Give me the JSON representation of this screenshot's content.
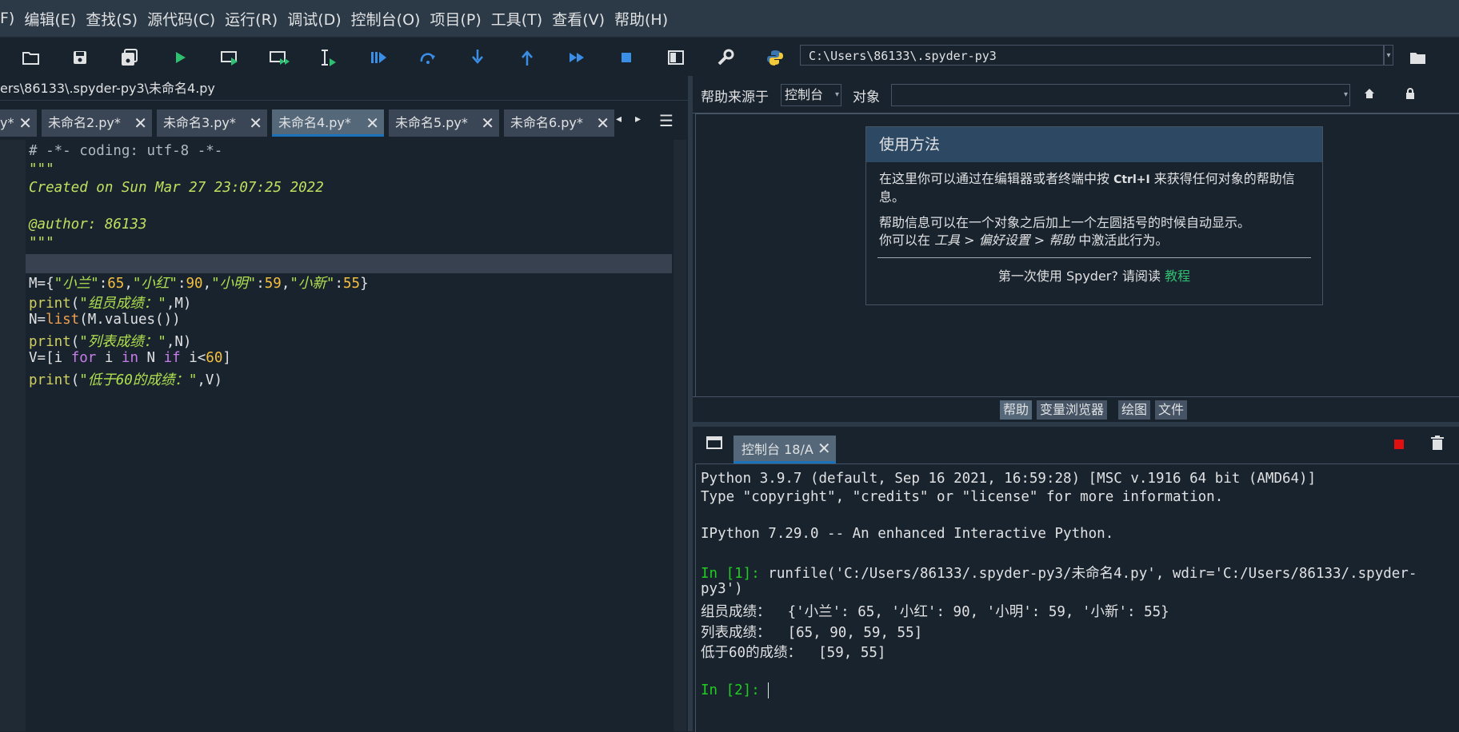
{
  "menu": [
    "F)",
    "编辑(E)",
    "查找(S)",
    "源代码(C)",
    "运行(R)",
    "调试(D)",
    "控制台(O)",
    "项目(P)",
    "工具(T)",
    "查看(V)",
    "帮助(H)"
  ],
  "toolbar": {
    "path": "C:\\Users\\86133\\.spyder-py3",
    "icons": [
      "open-folder",
      "save",
      "save-all",
      "run",
      "run-cell",
      "run-cell-advance",
      "run-selection",
      "debug",
      "step",
      "step-into",
      "step-return",
      "continue",
      "stop",
      "maximize-pane",
      "preferences",
      "pythonpath-manager"
    ]
  },
  "editor": {
    "path": "ers\\86133\\.spyder-py3\\未命名4.py",
    "tabs": [
      "y*",
      "未命名2.py*",
      "未命名3.py*",
      "未命名4.py*",
      "未命名5.py*",
      "未命名6.py*"
    ],
    "active_tab": "未命名4.py*",
    "code": {
      "l1": "# -*- coding: utf-8 -*-",
      "l2": "\"\"\"",
      "l3": "Created on Sun Mar 27 23:07:25 2022",
      "l5": "@author: 86133",
      "l6": "\"\"\"",
      "l8": {
        "a": "M={",
        "s1": "\"小兰\"",
        "b": ":",
        "n1": "65",
        "c": ",",
        "s2": "\"小红\"",
        "d": ":",
        "n2": "90",
        "e": ",",
        "s3": "\"小明\"",
        "f": ":",
        "n3": "59",
        "g": ",",
        "s4": "\"小新\"",
        "h": ":",
        "n4": "55",
        "i": "}"
      },
      "l9": {
        "fn": "print",
        "a": "(",
        "s": "\"组员成绩：\"",
        "b": ",M)"
      },
      "l10": {
        "a": "N=",
        "bi": "list",
        "b": "(M.values())"
      },
      "l11": {
        "fn": "print",
        "a": "(",
        "s": "\"列表成绩：\"",
        "b": ",N)"
      },
      "l12": {
        "a": "V=[i ",
        "k1": "for",
        "b": " i ",
        "k2": "in",
        "c": " N ",
        "k3": "if",
        "d": " i<",
        "n": "60",
        "e": "]"
      },
      "l13": {
        "fn": "print",
        "a": "(",
        "s": "\"低于60的成绩：\"",
        "b": ",V)"
      }
    }
  },
  "help": {
    "source_label": "帮助来源于",
    "source_value": "控制台",
    "object_label": "对象",
    "object_value": "",
    "card_title": "使用方法",
    "p1_a": "在这里你可以通过在编辑器或者终端中按 ",
    "p1_key": "Ctrl+I",
    "p1_b": " 来获得任何对象的帮助信息。",
    "p2": "帮助信息可以在一个对象之后加上一个左圆括号的时候自动显示。",
    "p3_a": "你可以在 ",
    "p3_em": "工具 > 偏好设置 > 帮助",
    "p3_b": " 中激活此行为。",
    "footer_a": "第一次使用 Spyder? 请阅读 ",
    "footer_link": "教程"
  },
  "pane_tabs": [
    "帮助",
    "变量浏览器",
    "绘图",
    "文件"
  ],
  "console": {
    "tab": "控制台 18/A",
    "lines": {
      "c1": "Python 3.9.7 (default, Sep 16 2021, 16:59:28) [MSC v.1916 64 bit (AMD64)]",
      "c2": "Type \"copyright\", \"credits\" or \"license\" for more information.",
      "c3": "IPython 7.29.0 -- An enhanced Interactive Python.",
      "p1": "In [1]: ",
      "c4": "runfile('C:/Users/86133/.spyder-py3/未命名4.py', wdir='C:/Users/86133/.spyder-",
      "c5": "py3')",
      "c6": "组员成绩：  {'小兰': 65, '小红': 90, '小明': 59, '小新': 55}",
      "c7": "列表成绩：  [65, 90, 59, 55]",
      "c8": "低于60的成绩：  [59, 55]",
      "p2": "In [2]: "
    }
  },
  "colors": {
    "background": "#19232d",
    "accent": "#1a72bb",
    "prompt": "#1fce1f",
    "stop": "#e01010"
  }
}
